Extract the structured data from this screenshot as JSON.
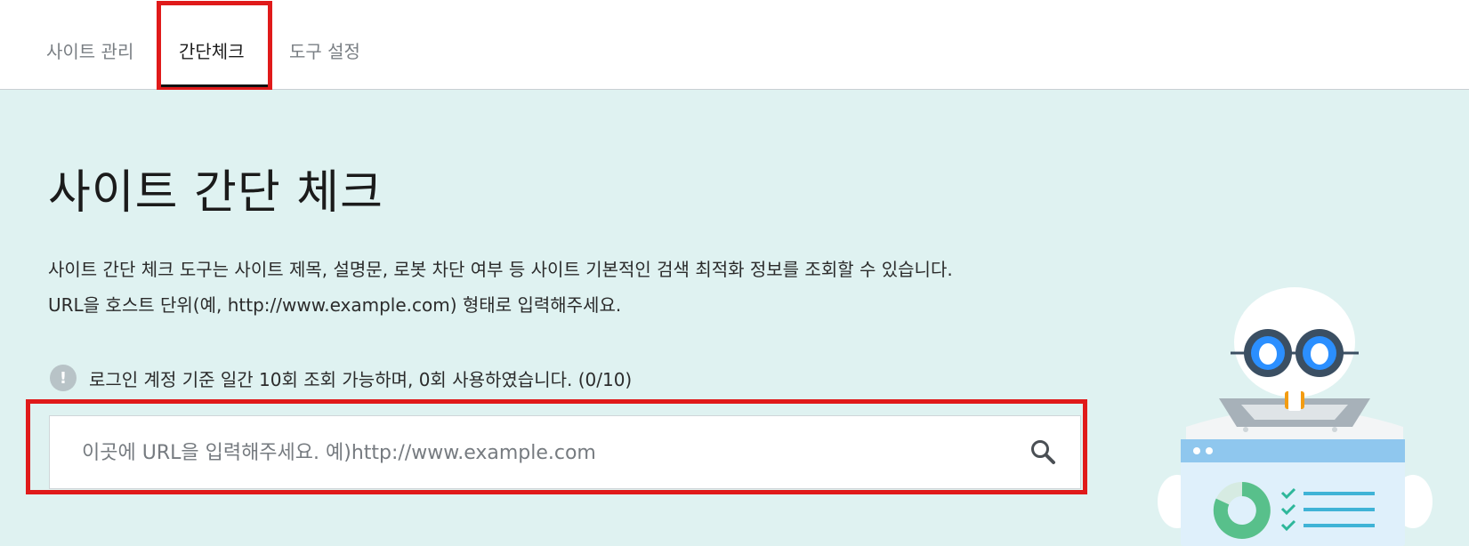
{
  "nav": {
    "tabs": [
      {
        "label": "사이트 관리"
      },
      {
        "label": "간단체크",
        "active": true
      },
      {
        "label": "도구 설정"
      }
    ]
  },
  "main": {
    "title": "사이트 간단 체크",
    "description": [
      "사이트 간단 체크 도구는 사이트 제목, 설명문, 로봇 차단 여부 등 사이트 기본적인 검색 최적화 정보를 조회할 수 있습니다.",
      "URL을 호스트 단위(예, http://www.example.com) 형태로 입력해주세요."
    ],
    "notice": {
      "icon": "exclamation-icon",
      "text": "로그인 계정 기준 일간 10회 조회 가능하며, 0회 사용하였습니다. (0/10)"
    },
    "search": {
      "value": "",
      "placeholder": "이곳에 URL을 입력해주세요. 예)http://www.example.com",
      "icon": "search-icon"
    }
  },
  "colors": {
    "highlight": "#e01a1a",
    "background": "#dff2f1",
    "robot_eye": "#2b8fff"
  }
}
